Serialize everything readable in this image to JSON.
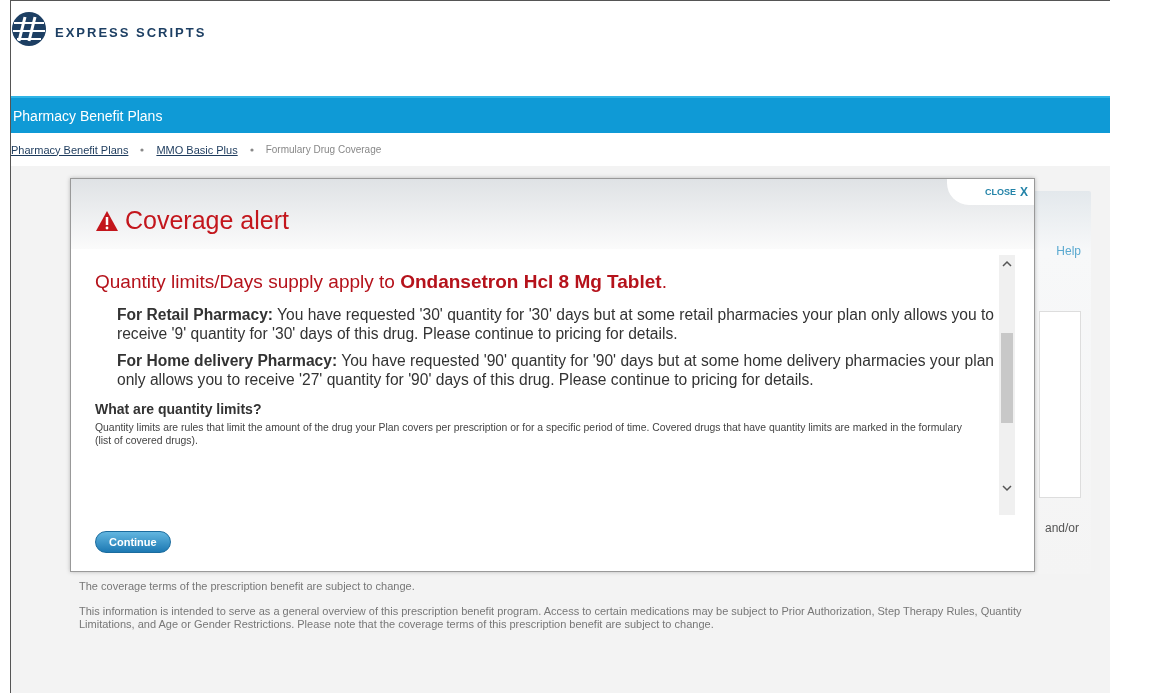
{
  "header": {
    "logo_text": "EXPRESS SCRIPTS"
  },
  "nav_bar": {
    "title": "Pharmacy Benefit Plans"
  },
  "breadcrumb": [
    {
      "label": "Pharmacy Benefit Plans",
      "kind": "link"
    },
    {
      "label": "MMO Basic Plus",
      "kind": "link"
    },
    {
      "label": "Formulary Drug Coverage",
      "kind": "current"
    }
  ],
  "background": {
    "help_link": "Help",
    "side_text": "and/or",
    "notes": [
      "The coverage terms of the prescription benefit are subject to change.",
      "This information is intended to serve as a general overview of this prescription benefit program. Access to certain medications may be subject to Prior Authorization, Step Therapy Rules, Quantity Limitations, and Age or Gender Restrictions. Please note that the coverage terms of this prescription benefit are subject to change."
    ]
  },
  "dialog": {
    "close_label": "CLOSE",
    "close_glyph": "X",
    "title": "Coverage alert",
    "headline": "Quantity limits/Days supply apply to **Ondansetron Hcl 8 Mg Tablet**.",
    "items": [
      {
        "label": "For Retail Pharmacy:",
        "text": "You have requested '30' quantity for '30' days but at some retail pharmacies your plan only allows you to receive '9' quantity for '30' days of this drug. Please continue to pricing for details."
      },
      {
        "label": "For Home delivery Pharmacy:",
        "text": "You have requested '90' quantity for '90' days but at some home delivery pharmacies your plan only allows you to receive '27' quantity for '90' days of this drug. Please continue to pricing for details."
      }
    ],
    "question": "What are quantity limits?",
    "answer": "Quantity limits are rules that limit the amount of the drug your Plan covers per prescription or for a specific period of time. Covered drugs that have quantity limits are marked in the formulary (list of covered drugs).",
    "button": "Continue"
  }
}
